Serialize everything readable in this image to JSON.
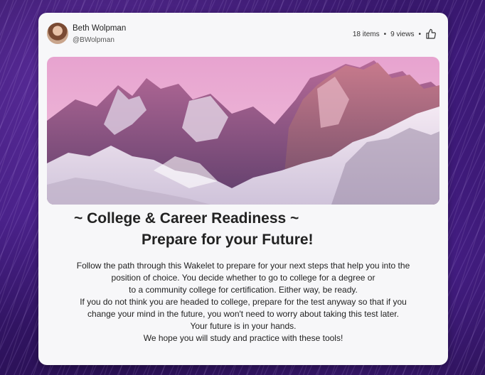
{
  "author": {
    "name": "Beth Wolpman",
    "handle": "@BWolpman"
  },
  "stats": {
    "items": "18 items",
    "separator": "•",
    "views": "9 views"
  },
  "icons": {
    "like": "thumbs-up-icon",
    "avatar": "profile-photo"
  },
  "title": {
    "line1": "~ College & Career Readiness ~",
    "line2": "Prepare for your Future!"
  },
  "description": {
    "lines": [
      "Follow the path through this Wakelet to prepare for your next steps that help you into the",
      "position of choice. You decide whether to go to college for a degree or",
      "to a community college for certification. Either way, be ready.",
      "If you do not think you are headed to college, prepare for the test anyway so that if you",
      "change your mind in the future, you won't need to worry about taking this test later.",
      "Your future is in your hands.",
      "We hope you will study and practice with these tools!"
    ]
  },
  "colors": {
    "background": "#3d1a78",
    "card": "#f7f7f9",
    "text": "#222222",
    "sky": "#e7a3cf"
  }
}
